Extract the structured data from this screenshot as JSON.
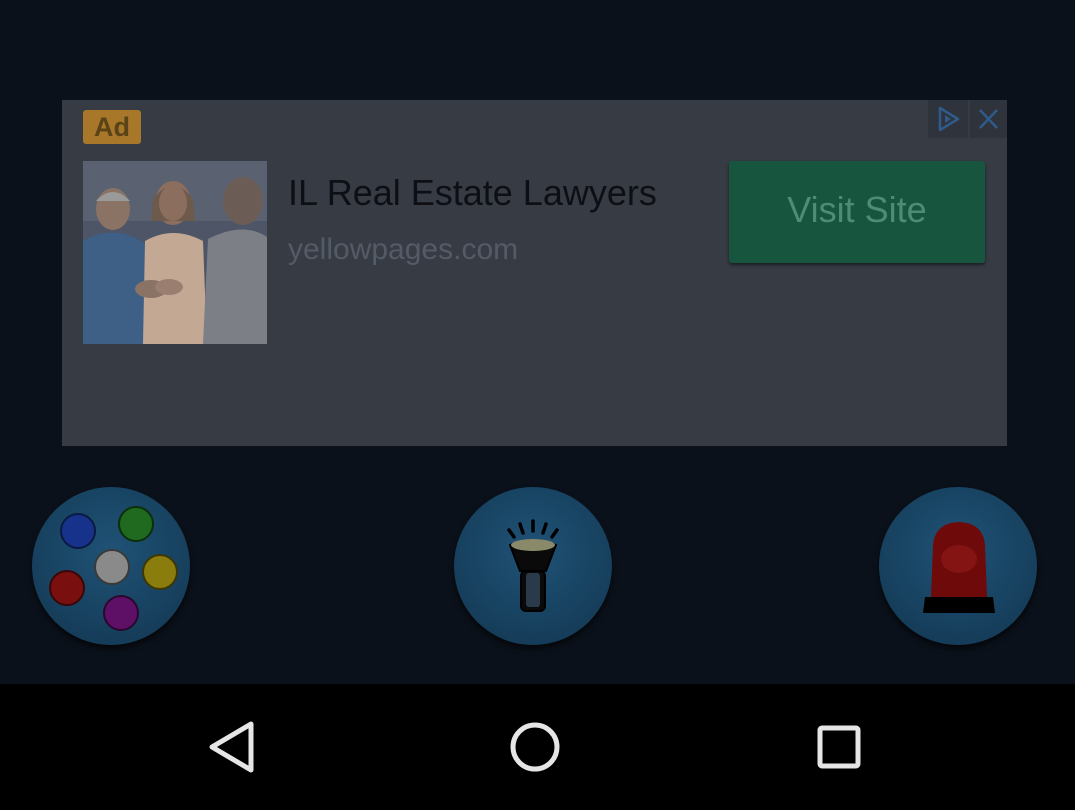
{
  "ad": {
    "badge": "Ad",
    "title": "IL Real Estate Lawyers",
    "url": "yellowpages.com",
    "cta": "Visit Site",
    "choices_icon": "ad-choices-icon",
    "close_icon": "close-icon",
    "image": "people-handshake-photo"
  },
  "tools": [
    {
      "name": "color-palette",
      "icon": "palette-icon"
    },
    {
      "name": "flashlight",
      "icon": "flashlight-icon"
    },
    {
      "name": "police-light",
      "icon": "siren-icon"
    }
  ],
  "nav": {
    "back_icon": "back-triangle-icon",
    "home_icon": "home-circle-icon",
    "recents_icon": "recents-square-icon"
  },
  "colors": {
    "background": "#0b111a",
    "ad_background": "#363b44",
    "cta": "#17553f",
    "badge": "#a8772a"
  }
}
